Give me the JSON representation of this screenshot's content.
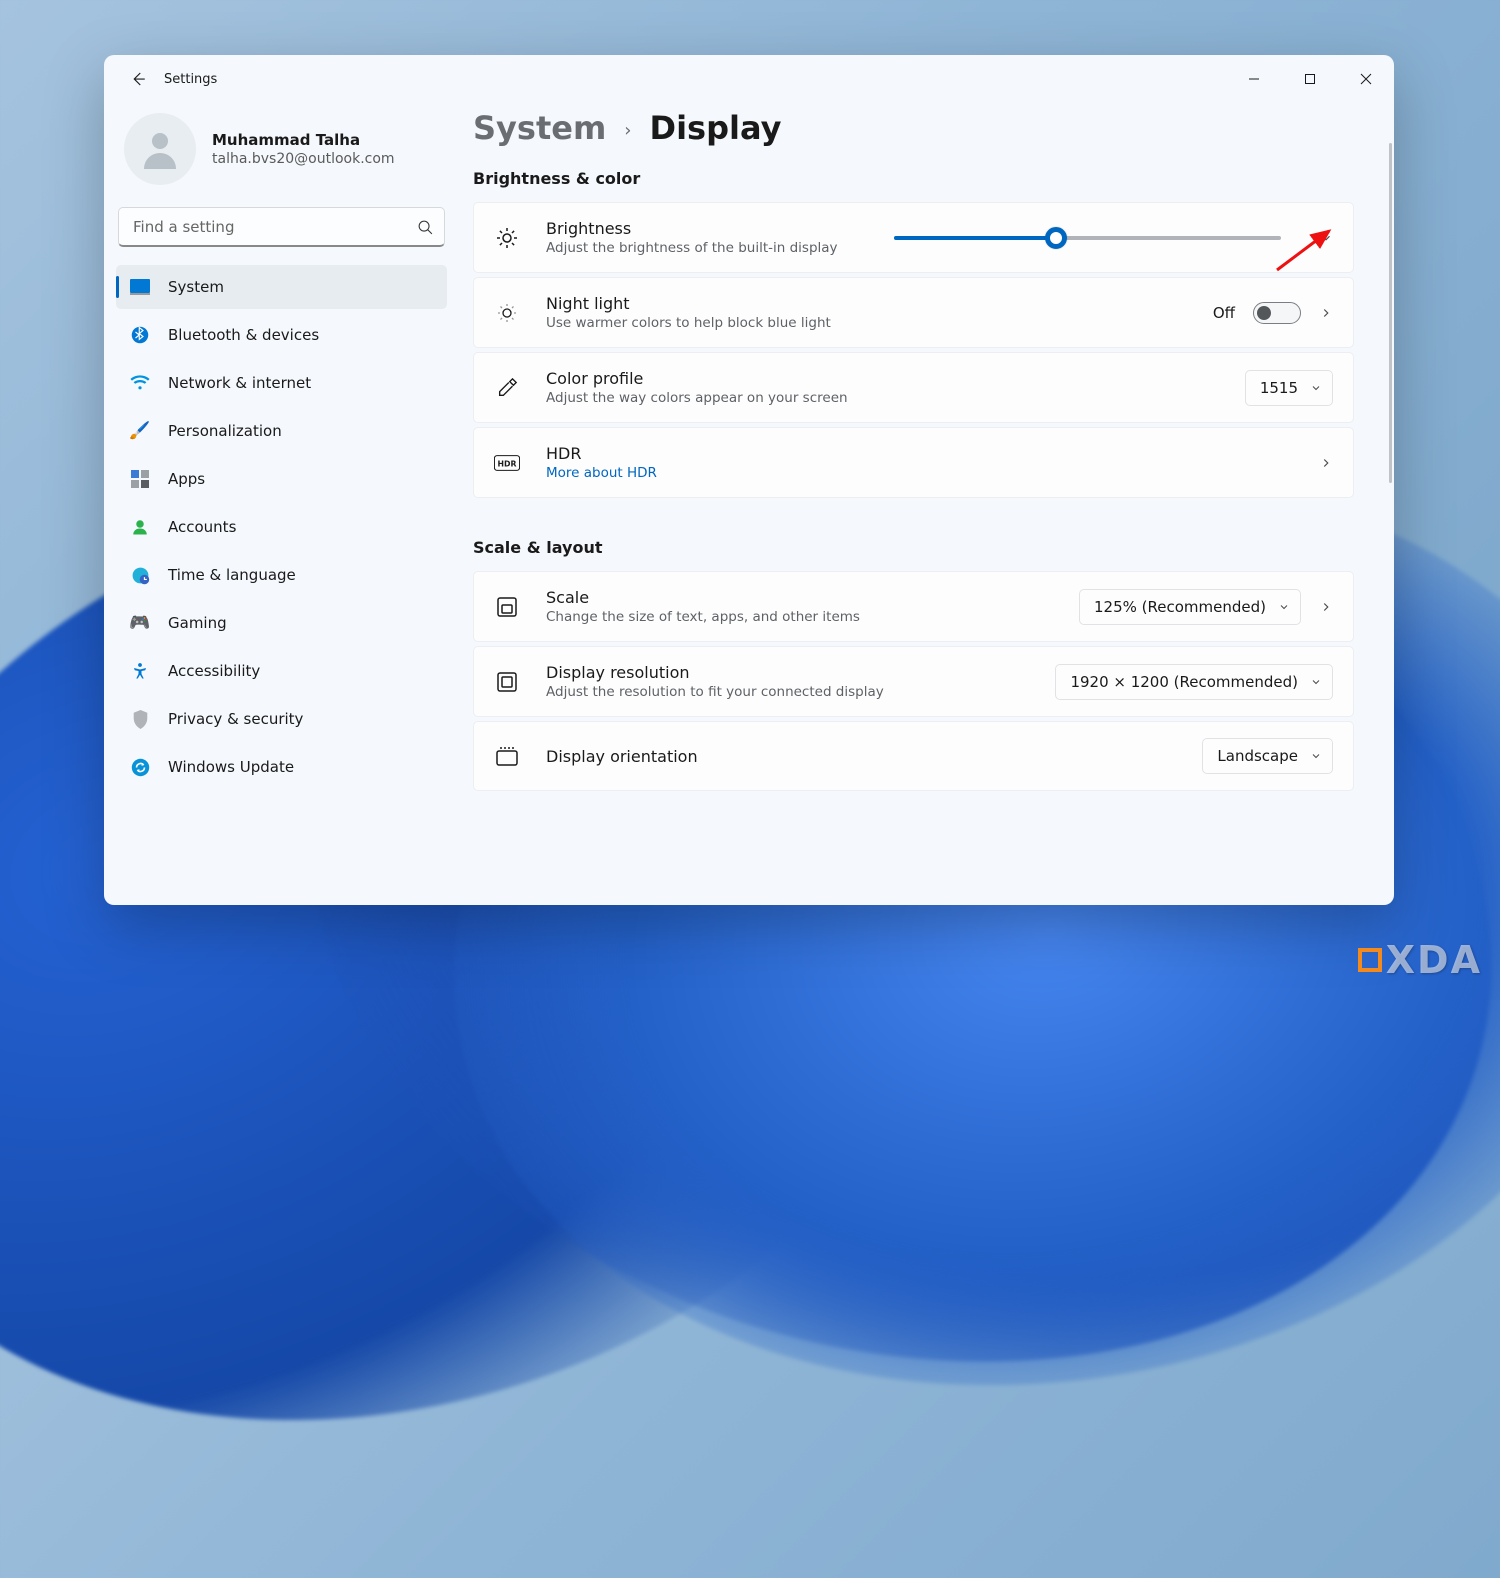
{
  "window_title": "Settings",
  "user": {
    "name": "Muhammad Talha",
    "email": "talha.bvs20@outlook.com"
  },
  "search": {
    "placeholder": "Find a setting"
  },
  "nav": {
    "items": [
      {
        "label": "System"
      },
      {
        "label": "Bluetooth & devices"
      },
      {
        "label": "Network & internet"
      },
      {
        "label": "Personalization"
      },
      {
        "label": "Apps"
      },
      {
        "label": "Accounts"
      },
      {
        "label": "Time & language"
      },
      {
        "label": "Gaming"
      },
      {
        "label": "Accessibility"
      },
      {
        "label": "Privacy & security"
      },
      {
        "label": "Windows Update"
      }
    ],
    "active_index": 0
  },
  "breadcrumb": {
    "parent": "System",
    "page": "Display"
  },
  "sections": {
    "brightness_color": {
      "heading": "Brightness & color",
      "brightness": {
        "title": "Brightness",
        "sub": "Adjust the brightness of the built-in display",
        "value_pct": 42
      },
      "night_light": {
        "title": "Night light",
        "sub": "Use warmer colors to help block blue light",
        "state_label": "Off",
        "on": false
      },
      "color_profile": {
        "title": "Color profile",
        "sub": "Adjust the way colors appear on your screen",
        "value": "1515"
      },
      "hdr": {
        "title": "HDR",
        "link": "More about HDR"
      }
    },
    "scale_layout": {
      "heading": "Scale & layout",
      "scale": {
        "title": "Scale",
        "sub": "Change the size of text, apps, and other items",
        "value": "125% (Recommended)"
      },
      "resolution": {
        "title": "Display resolution",
        "sub": "Adjust the resolution to fit your connected display",
        "value": "1920 × 1200 (Recommended)"
      },
      "orientation": {
        "title": "Display orientation",
        "value": "Landscape"
      }
    }
  },
  "watermark": "XDA"
}
